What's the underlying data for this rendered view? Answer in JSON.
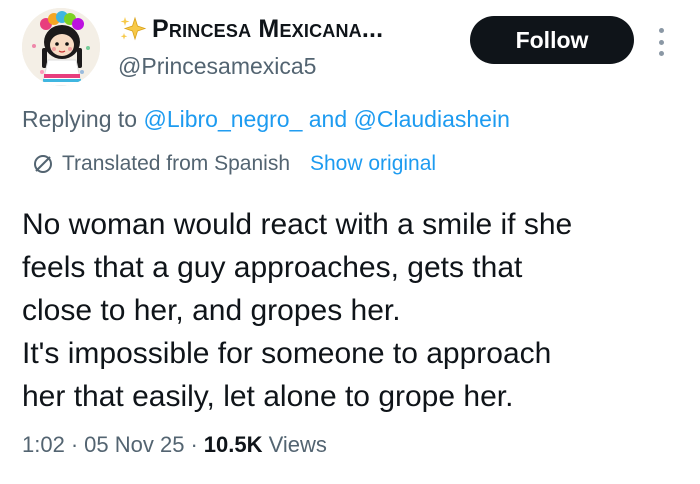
{
  "author": {
    "display_name": "Princesa Mexicana...",
    "handle": "@Princesamexica5"
  },
  "follow_button": {
    "label": "Follow"
  },
  "reply_context": {
    "prefix": "Replying to",
    "mention_1": "@Libro_negro_",
    "connector": "and",
    "mention_2": "@Claudiashein"
  },
  "translation": {
    "label": "Translated from Spanish",
    "show_original": "Show original"
  },
  "tweet": {
    "lines": [
      "No woman would react with a smile if she",
      "feels that a guy approaches, gets that",
      "close to her, and gropes her.",
      "It's impossible for someone to approach",
      "her that easily, let alone to grope her."
    ]
  },
  "meta": {
    "time": "1:02",
    "date": "05 Nov 25",
    "views_count": "10.5K",
    "views_label": "Views"
  },
  "colors": {
    "link": "#1d9bf0",
    "secondary_text": "#536471",
    "primary_text": "#0f1419",
    "button_bg": "#0f1419"
  },
  "icons": {
    "avatar": "doll-avatar",
    "badge": "sparkles-icon",
    "more": "more-vertical-icon",
    "translate": "globe-icon"
  }
}
